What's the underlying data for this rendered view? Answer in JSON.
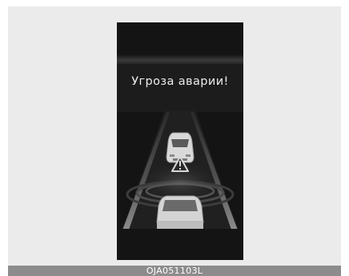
{
  "display": {
    "warning_message": "Угроза аварии!",
    "icon": "collision-warning-icon"
  },
  "caption": {
    "code": "OJA051103L"
  },
  "colors": {
    "frame_background": "#ebebeb",
    "display_background": "#141414",
    "caption_bar": "#8c8c8c"
  }
}
